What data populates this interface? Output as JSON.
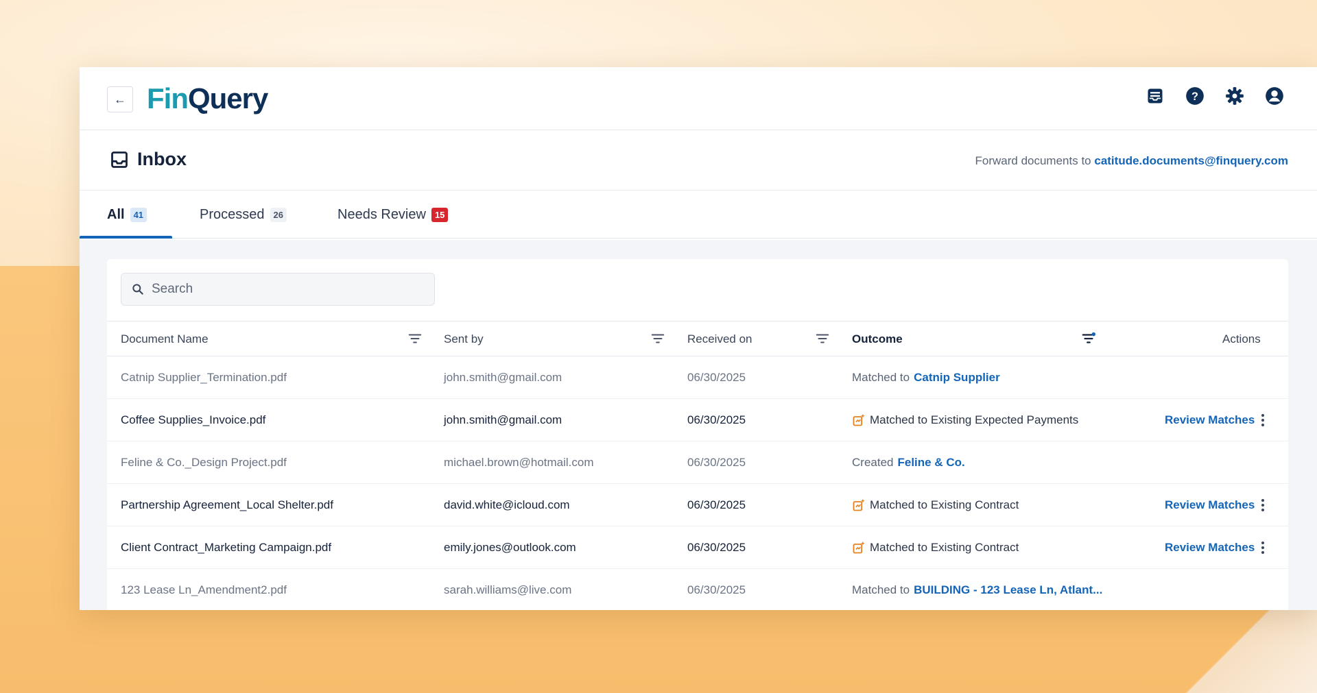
{
  "app": {
    "logo_fin": "Fin",
    "logo_query": "Query",
    "top_icons": [
      "inbox-tray-icon",
      "help-icon",
      "gear-icon",
      "user-account-icon"
    ]
  },
  "inbox": {
    "title": "Inbox",
    "forward_label": "Forward documents to ",
    "forward_email": "catitude.documents@finquery.com"
  },
  "tabs": [
    {
      "label": "All",
      "count": "41"
    },
    {
      "label": "Processed",
      "count": "26"
    },
    {
      "label": "Needs Review",
      "count": "15"
    }
  ],
  "search": {
    "placeholder": "Search",
    "value": ""
  },
  "table": {
    "columns": [
      "Document Name",
      "Sent by",
      "Received on",
      "Outcome",
      "Actions"
    ],
    "rows": [
      {
        "name": "Catnip Supplier_Termination.pdf",
        "sender": "john.smith@gmail.com",
        "date": "06/30/2025",
        "outcome_prefix": "Matched to ",
        "outcome_link": "Catnip Supplier",
        "action": ""
      },
      {
        "name": "Coffee Supplies_Invoice.pdf",
        "sender": "john.smith@gmail.com",
        "date": "06/30/2025",
        "outcome_prefix": "Matched to Existing Expected Payments",
        "outcome_link": "",
        "action": "Review Matches"
      },
      {
        "name": "Feline & Co._Design Project.pdf",
        "sender": "michael.brown@hotmail.com",
        "date": "06/30/2025",
        "outcome_prefix": "Created ",
        "outcome_link": "Feline & Co.",
        "action": ""
      },
      {
        "name": "Partnership Agreement_Local Shelter.pdf",
        "sender": "david.white@icloud.com",
        "date": "06/30/2025",
        "outcome_prefix": "Matched to Existing Contract",
        "outcome_link": "",
        "action": "Review Matches"
      },
      {
        "name": "Client Contract_Marketing Campaign.pdf",
        "sender": "emily.jones@outlook.com",
        "date": "06/30/2025",
        "outcome_prefix": "Matched to Existing Contract",
        "outcome_link": "",
        "action": "Review Matches"
      },
      {
        "name": "123 Lease Ln_Amendment2.pdf",
        "sender": "sarah.williams@live.com",
        "date": "06/30/2025",
        "outcome_prefix": "Matched to ",
        "outcome_link": "BUILDING - 123 Lease Ln, Atlant...",
        "action": ""
      }
    ]
  },
  "colors": {
    "accent": "#1465b7",
    "brand_teal": "#1a9bb0",
    "brand_navy": "#0e2f57",
    "alert": "#d7262e",
    "match_icon": "#e8821f"
  }
}
